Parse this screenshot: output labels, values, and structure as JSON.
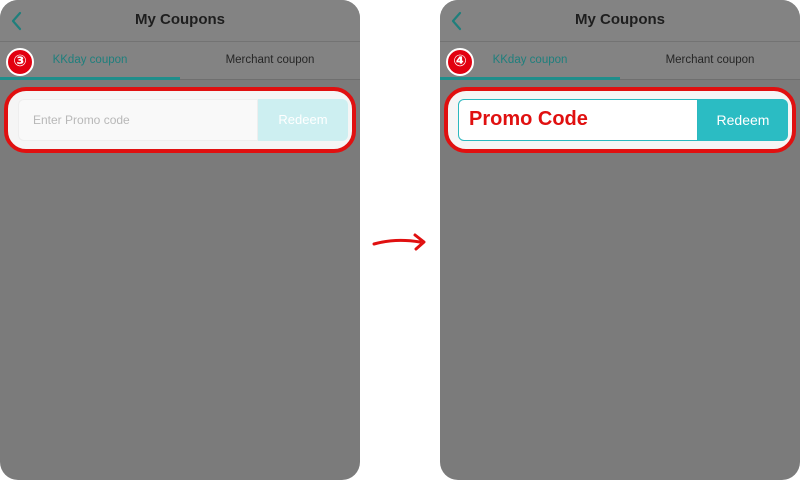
{
  "left_screen": {
    "header": {
      "title": "My Coupons",
      "back_icon": "chevron-left-icon"
    },
    "tabs": [
      {
        "label": "KKday coupon",
        "active": true
      },
      {
        "label": "Merchant coupon",
        "active": false
      }
    ],
    "step_badge": "③",
    "promo": {
      "placeholder": "Enter Promo code",
      "value": "",
      "redeem_label": "Redeem",
      "redeem_enabled": false
    }
  },
  "right_screen": {
    "header": {
      "title": "My Coupons",
      "back_icon": "chevron-left-icon"
    },
    "tabs": [
      {
        "label": "KKday coupon",
        "active": true
      },
      {
        "label": "Merchant coupon",
        "active": false
      }
    ],
    "step_badge": "④",
    "promo": {
      "value": "Promo Code",
      "redeem_label": "Redeem",
      "redeem_enabled": true
    }
  },
  "colors": {
    "accent": "#2bbcc3",
    "highlight_red": "#e01010",
    "overlay_gray": "#7b7b7b"
  },
  "flow_arrow_icon": "arrow-right-icon"
}
